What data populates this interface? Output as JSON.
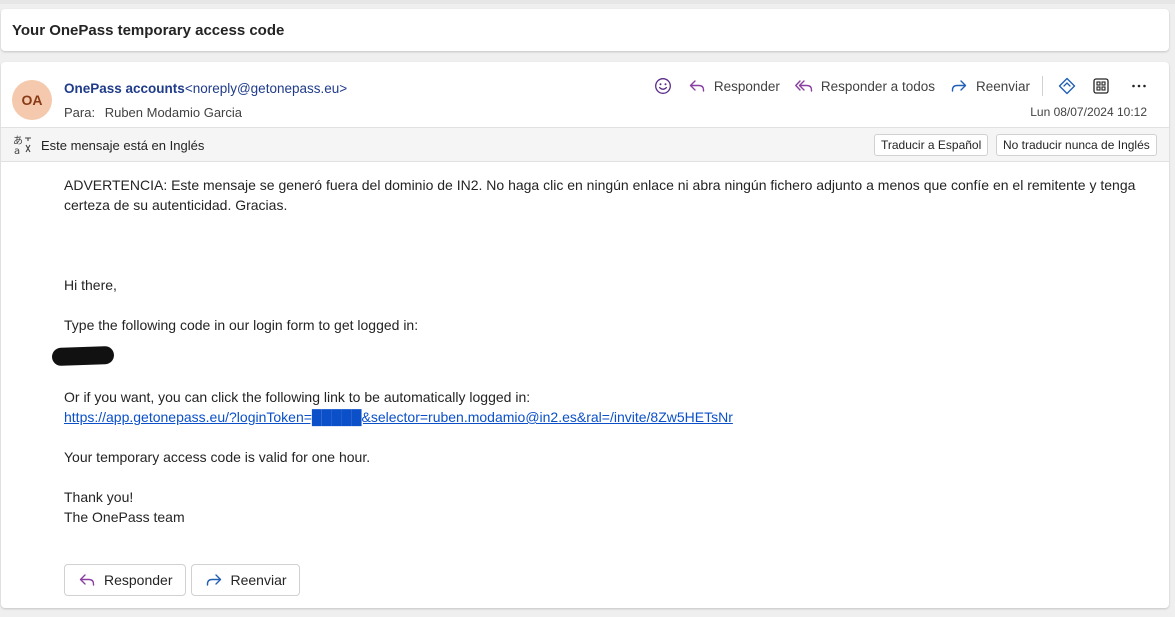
{
  "subject": "Your OnePass temporary access code",
  "sender": {
    "initials": "OA",
    "name": "OnePass accounts",
    "email": "<noreply@getonepass.eu>",
    "to_label": "Para:",
    "to_name": "Ruben Modamio Garcia",
    "date": "Lun 08/07/2024 10:12"
  },
  "toolbar": {
    "reply": "Responder",
    "reply_all": "Responder a todos",
    "forward": "Reenviar"
  },
  "translation": {
    "message": "Este mensaje está en Inglés",
    "translate_button": "Traducir a Español",
    "never_button": "No traducir nunca de Inglés"
  },
  "body": {
    "warning": "ADVERTENCIA: Este mensaje se generó fuera del dominio de IN2. No haga clic en ningún enlace ni abra ningún fichero adjunto a menos que confíe en el remitente y tenga certeza de su autenticidad. Gracias.",
    "greeting": "Hi there,",
    "instruction": "Type the following code in our login form to get logged in:",
    "link_intro": "Or if you want, you can click the following link to be automatically logged in:",
    "link_text": "https://app.getonepass.eu/?loginToken=█████&selector=ruben.modamio@in2.es&ral=/invite/8Zw5HETsNr",
    "validity": "Your temporary access code is valid for one hour.",
    "thanks": "Thank you!",
    "signature": "The OnePass team"
  },
  "footer_buttons": {
    "reply": "Responder",
    "forward": "Reenviar"
  },
  "colors": {
    "avatar_bg": "#f4c9ad",
    "link": "#0b50c8",
    "reply_icon": "#8a3ea0",
    "forward_icon": "#1f5fb4"
  }
}
